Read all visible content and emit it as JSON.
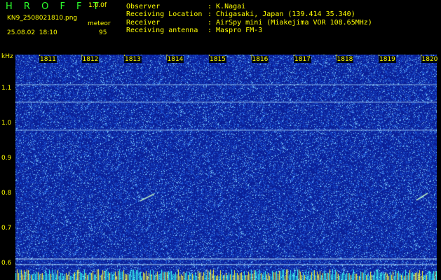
{
  "app": {
    "name": "H R O F F T",
    "version": "1.0.0f"
  },
  "file": {
    "name": "KN9_2508021810.png",
    "mode_label": "meteor",
    "count": "95",
    "timestamp": "25.08.02  18:10"
  },
  "station": {
    "observer_label": "Observer",
    "observer_value": ": K.Nagai",
    "location_label": "Receiving Location",
    "location_value": ": Chigasaki, Japan (139.414 35.340)",
    "receiver_label": "Receiver",
    "receiver_value": ": AirSpy mini (Miakejima VOR 108.65MHz)",
    "antenna_label": "Receiving antenna",
    "antenna_value": ": Maspro FM-3"
  },
  "axis": {
    "unit": "kHz",
    "y_ticks": [
      "1.1",
      "1.0",
      "0.9",
      "0.8",
      "0.7",
      "0.6"
    ],
    "x_ticks": [
      "1811",
      "1812",
      "1813",
      "1814",
      "1815",
      "1816",
      "1817",
      "1818",
      "1819",
      "1820"
    ]
  },
  "colors": {
    "background": "#0a1f9c",
    "text": "#ffff00",
    "brand": "#2cff2c"
  }
}
